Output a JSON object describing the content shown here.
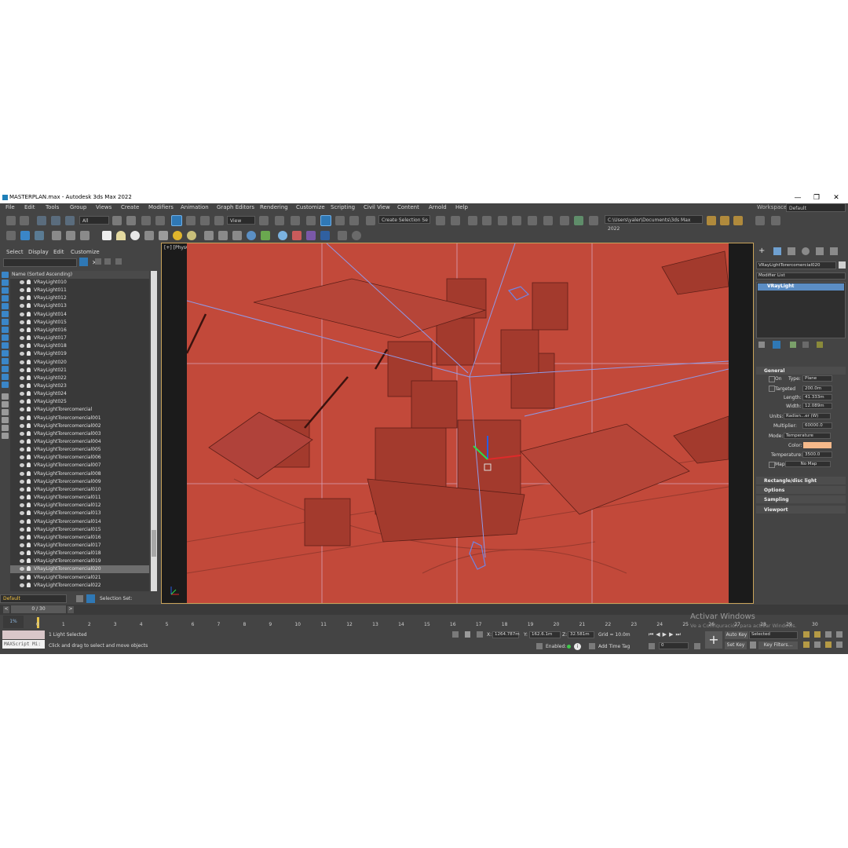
{
  "app": {
    "title": "MASTERPLAN.max - Autodesk 3ds Max 2022",
    "min": "—",
    "max": "❐",
    "close": "✕"
  },
  "menu": [
    "File",
    "Edit",
    "Tools",
    "Group",
    "Views",
    "Create",
    "Modifiers",
    "Animation",
    "Graph Editors",
    "Rendering",
    "Customize",
    "Scripting",
    "Civil View",
    "Content",
    "Arnold",
    "Help"
  ],
  "workspaces": {
    "label": "Workspaces:",
    "value": "Default"
  },
  "toolbar": {
    "filter": "All",
    "coord": "View",
    "selection_set": "Create Selection Se",
    "path": "C:\\Users\\yaler\\Documents\\3ds Max 2022"
  },
  "explorer": {
    "tabs": [
      "Select",
      "Display",
      "Edit",
      "Customize"
    ],
    "column_header": "Name (Sorted Ascending)",
    "rows": [
      "VRayLight010",
      "VRayLight011",
      "VRayLight012",
      "VRayLight013",
      "VRayLight014",
      "VRayLight015",
      "VRayLight016",
      "VRayLight017",
      "VRayLight018",
      "VRayLight019",
      "VRayLight020",
      "VRayLight021",
      "VRayLight022",
      "VRayLight023",
      "VRayLight024",
      "VRayLight025",
      "VRayLightTorercomercial",
      "VRayLightTorercomercial001",
      "VRayLightTorercomercial002",
      "VRayLightTorercomercial003",
      "VRayLightTorercomercial004",
      "VRayLightTorercomercial005",
      "VRayLightTorercomercial006",
      "VRayLightTorercomercial007",
      "VRayLightTorercomercial008",
      "VRayLightTorercomercial009",
      "VRayLightTorercomercial010",
      "VRayLightTorercomercial011",
      "VRayLightTorercomercial012",
      "VRayLightTorercomercial013",
      "VRayLightTorercomercial014",
      "VRayLightTorercomercial015",
      "VRayLightTorercomercial016",
      "VRayLightTorercomercial017",
      "VRayLightTorercomercial018",
      "VRayLightTorercomercial019",
      "VRayLightTorercomercial020",
      "VRayLightTorercomercial021",
      "VRayLightTorercomercial022"
    ],
    "selected_index": 36,
    "layer": "Default",
    "selection_set_label": "Selection Set:"
  },
  "viewport": {
    "label": "[+] [PhysCamera001] [Standard] [Clay]",
    "background_color": "#c2493a",
    "watermark_title": "Activar Windows",
    "watermark_sub": "Ve a Configuración para activar Windows."
  },
  "command_panel": {
    "object_name": "VRayLightTorercomercial020",
    "modifier_list": "Modifier List",
    "stack_item": "VRayLight",
    "general": {
      "title": "General",
      "on_label": "On",
      "type_label": "Type:",
      "type_value": "Plane",
      "targeted_label": "Targeted",
      "targeted_value": "200.0m",
      "length_label": "Length:",
      "length_value": "41.333m",
      "width_label": "Width:",
      "width_value": "12.089m",
      "units_label": "Units:",
      "units_value": "Radian...er (W)",
      "multiplier_label": "Multiplier:",
      "multiplier_value": "60000.0",
      "mode_label": "Mode:",
      "mode_value": "Temperature",
      "color_label": "Color:",
      "color_value": "#f5b98a",
      "temperature_label": "Temperature:",
      "temperature_value": "3500.0",
      "map_label": "Map",
      "map_value": "No Map"
    },
    "rollouts": [
      "Rectangle/disc light",
      "Options",
      "Sampling",
      "Viewport"
    ]
  },
  "timeline": {
    "frame_field": "0 / 30",
    "ticks": [
      "0",
      "1",
      "2",
      "3",
      "4",
      "5",
      "6",
      "7",
      "8",
      "9",
      "10",
      "11",
      "12",
      "13",
      "14",
      "15",
      "16",
      "17",
      "18",
      "19",
      "20",
      "21",
      "22",
      "23",
      "24",
      "25",
      "26",
      "27",
      "28",
      "29",
      "30"
    ],
    "left_box": "1%"
  },
  "status": {
    "maxscript": "MAXScript Mi:",
    "line1": "1 Light Selected",
    "line2": "Click and drag to select and move objects",
    "x_label": "X:",
    "x_value": "1264.787m",
    "y_label": "Y:",
    "y_value": "162.6.1m",
    "z_label": "Z:",
    "z_value": "32.581m",
    "grid": "Grid = 10.0m",
    "enabled": "Enabled:",
    "time_tag": "Add Time Tag",
    "auto_key": "Auto Key",
    "selected": "Selected",
    "set_key": "Set Key",
    "key_filters": "Key Filters...",
    "frame": "0"
  }
}
